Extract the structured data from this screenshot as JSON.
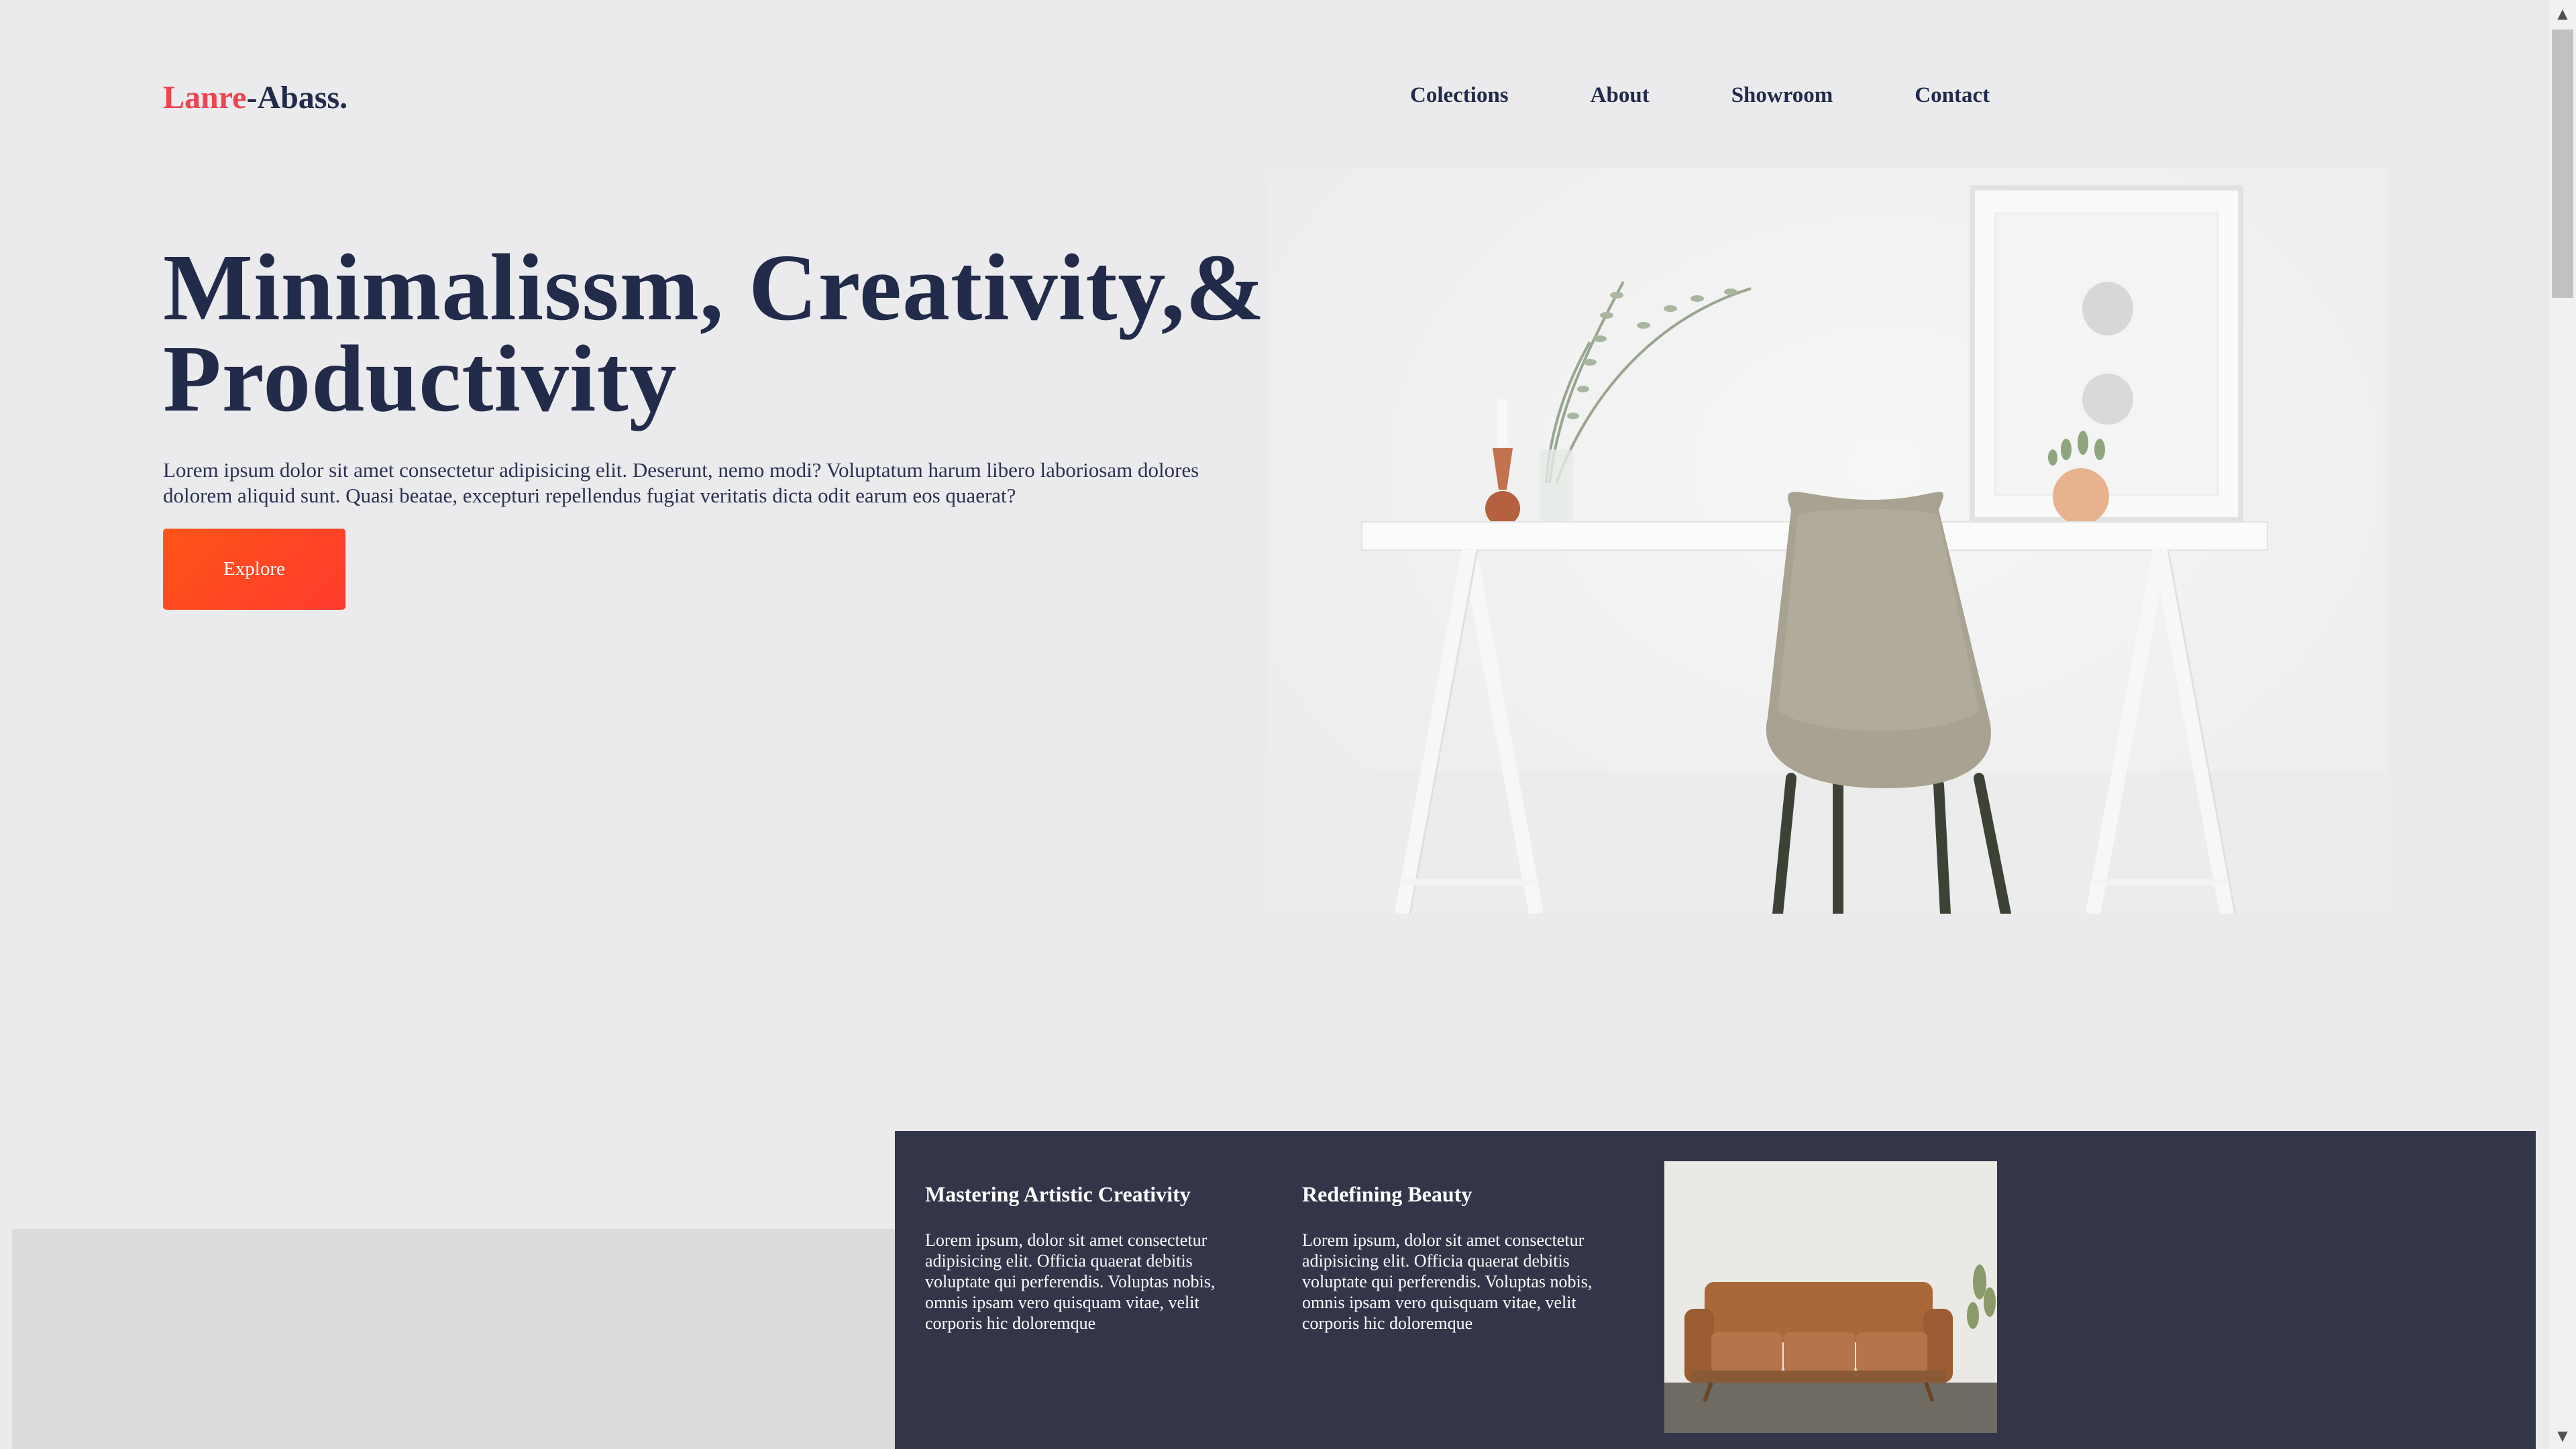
{
  "brand": {
    "part1": "Lanre",
    "part2": "-Abass.",
    "accent_color": "#f0434d",
    "primary_color": "#232b4a"
  },
  "nav": {
    "items": [
      "Colections",
      "About",
      "Showroom",
      "Contact"
    ]
  },
  "hero": {
    "title_line1": "Minimalissm, Creativity,&",
    "title_line2": "Productivity",
    "text": "Lorem ipsum dolor sit amet consectetur adipisicing elit. Deserunt, nemo modi? Voluptatum harum libero laboriosam dolores dolorem aliquid sunt. Quasi beatae, excepturi repellendus fugiat veritatis dicta odit earum eos quaerat?",
    "button_label": "Explore",
    "button_color": "#ff4a22"
  },
  "features": {
    "cards": [
      {
        "title": "Mastering Artistic Creativity",
        "text": "Lorem ipsum, dolor sit amet consectetur adipisicing elit. Officia quaerat debitis voluptate qui perferendis. Voluptas nobis, omnis ipsam vero quisquam vitae, velit corporis hic doloremque"
      },
      {
        "title": "Redefining Beauty",
        "text": "Lorem ipsum, dolor sit amet consectetur adipisicing elit. Officia quaerat debitis voluptate qui perferendis. Voluptas nobis, omnis ipsam vero quisquam vitae, velit corporis hic doloremque"
      }
    ],
    "background_color": "#333649"
  },
  "icons": {
    "scroll_up": "scroll-up-arrow-icon",
    "scroll_down": "scroll-down-arrow-icon"
  }
}
